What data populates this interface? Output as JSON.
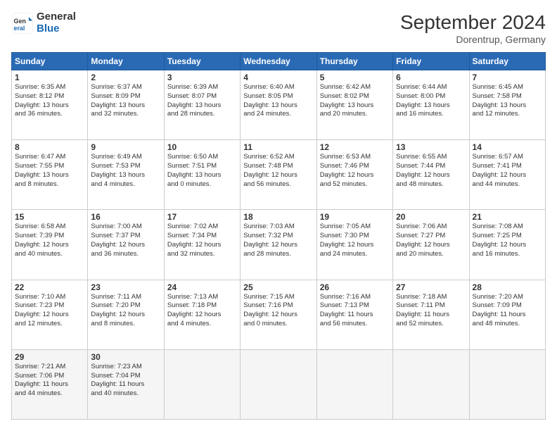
{
  "header": {
    "logo_general": "General",
    "logo_blue": "Blue",
    "title": "September 2024",
    "subtitle": "Dorentrup, Germany"
  },
  "weekdays": [
    "Sunday",
    "Monday",
    "Tuesday",
    "Wednesday",
    "Thursday",
    "Friday",
    "Saturday"
  ],
  "weeks": [
    [
      {
        "day": "1",
        "lines": [
          "Sunrise: 6:35 AM",
          "Sunset: 8:12 PM",
          "Daylight: 13 hours",
          "and 36 minutes."
        ]
      },
      {
        "day": "2",
        "lines": [
          "Sunrise: 6:37 AM",
          "Sunset: 8:09 PM",
          "Daylight: 13 hours",
          "and 32 minutes."
        ]
      },
      {
        "day": "3",
        "lines": [
          "Sunrise: 6:39 AM",
          "Sunset: 8:07 PM",
          "Daylight: 13 hours",
          "and 28 minutes."
        ]
      },
      {
        "day": "4",
        "lines": [
          "Sunrise: 6:40 AM",
          "Sunset: 8:05 PM",
          "Daylight: 13 hours",
          "and 24 minutes."
        ]
      },
      {
        "day": "5",
        "lines": [
          "Sunrise: 6:42 AM",
          "Sunset: 8:02 PM",
          "Daylight: 13 hours",
          "and 20 minutes."
        ]
      },
      {
        "day": "6",
        "lines": [
          "Sunrise: 6:44 AM",
          "Sunset: 8:00 PM",
          "Daylight: 13 hours",
          "and 16 minutes."
        ]
      },
      {
        "day": "7",
        "lines": [
          "Sunrise: 6:45 AM",
          "Sunset: 7:58 PM",
          "Daylight: 13 hours",
          "and 12 minutes."
        ]
      }
    ],
    [
      {
        "day": "8",
        "lines": [
          "Sunrise: 6:47 AM",
          "Sunset: 7:55 PM",
          "Daylight: 13 hours",
          "and 8 minutes."
        ]
      },
      {
        "day": "9",
        "lines": [
          "Sunrise: 6:49 AM",
          "Sunset: 7:53 PM",
          "Daylight: 13 hours",
          "and 4 minutes."
        ]
      },
      {
        "day": "10",
        "lines": [
          "Sunrise: 6:50 AM",
          "Sunset: 7:51 PM",
          "Daylight: 13 hours",
          "and 0 minutes."
        ]
      },
      {
        "day": "11",
        "lines": [
          "Sunrise: 6:52 AM",
          "Sunset: 7:48 PM",
          "Daylight: 12 hours",
          "and 56 minutes."
        ]
      },
      {
        "day": "12",
        "lines": [
          "Sunrise: 6:53 AM",
          "Sunset: 7:46 PM",
          "Daylight: 12 hours",
          "and 52 minutes."
        ]
      },
      {
        "day": "13",
        "lines": [
          "Sunrise: 6:55 AM",
          "Sunset: 7:44 PM",
          "Daylight: 12 hours",
          "and 48 minutes."
        ]
      },
      {
        "day": "14",
        "lines": [
          "Sunrise: 6:57 AM",
          "Sunset: 7:41 PM",
          "Daylight: 12 hours",
          "and 44 minutes."
        ]
      }
    ],
    [
      {
        "day": "15",
        "lines": [
          "Sunrise: 6:58 AM",
          "Sunset: 7:39 PM",
          "Daylight: 12 hours",
          "and 40 minutes."
        ]
      },
      {
        "day": "16",
        "lines": [
          "Sunrise: 7:00 AM",
          "Sunset: 7:37 PM",
          "Daylight: 12 hours",
          "and 36 minutes."
        ]
      },
      {
        "day": "17",
        "lines": [
          "Sunrise: 7:02 AM",
          "Sunset: 7:34 PM",
          "Daylight: 12 hours",
          "and 32 minutes."
        ]
      },
      {
        "day": "18",
        "lines": [
          "Sunrise: 7:03 AM",
          "Sunset: 7:32 PM",
          "Daylight: 12 hours",
          "and 28 minutes."
        ]
      },
      {
        "day": "19",
        "lines": [
          "Sunrise: 7:05 AM",
          "Sunset: 7:30 PM",
          "Daylight: 12 hours",
          "and 24 minutes."
        ]
      },
      {
        "day": "20",
        "lines": [
          "Sunrise: 7:06 AM",
          "Sunset: 7:27 PM",
          "Daylight: 12 hours",
          "and 20 minutes."
        ]
      },
      {
        "day": "21",
        "lines": [
          "Sunrise: 7:08 AM",
          "Sunset: 7:25 PM",
          "Daylight: 12 hours",
          "and 16 minutes."
        ]
      }
    ],
    [
      {
        "day": "22",
        "lines": [
          "Sunrise: 7:10 AM",
          "Sunset: 7:23 PM",
          "Daylight: 12 hours",
          "and 12 minutes."
        ]
      },
      {
        "day": "23",
        "lines": [
          "Sunrise: 7:11 AM",
          "Sunset: 7:20 PM",
          "Daylight: 12 hours",
          "and 8 minutes."
        ]
      },
      {
        "day": "24",
        "lines": [
          "Sunrise: 7:13 AM",
          "Sunset: 7:18 PM",
          "Daylight: 12 hours",
          "and 4 minutes."
        ]
      },
      {
        "day": "25",
        "lines": [
          "Sunrise: 7:15 AM",
          "Sunset: 7:16 PM",
          "Daylight: 12 hours",
          "and 0 minutes."
        ]
      },
      {
        "day": "26",
        "lines": [
          "Sunrise: 7:16 AM",
          "Sunset: 7:13 PM",
          "Daylight: 11 hours",
          "and 56 minutes."
        ]
      },
      {
        "day": "27",
        "lines": [
          "Sunrise: 7:18 AM",
          "Sunset: 7:11 PM",
          "Daylight: 11 hours",
          "and 52 minutes."
        ]
      },
      {
        "day": "28",
        "lines": [
          "Sunrise: 7:20 AM",
          "Sunset: 7:09 PM",
          "Daylight: 11 hours",
          "and 48 minutes."
        ]
      }
    ],
    [
      {
        "day": "29",
        "lines": [
          "Sunrise: 7:21 AM",
          "Sunset: 7:06 PM",
          "Daylight: 11 hours",
          "and 44 minutes."
        ]
      },
      {
        "day": "30",
        "lines": [
          "Sunrise: 7:23 AM",
          "Sunset: 7:04 PM",
          "Daylight: 11 hours",
          "and 40 minutes."
        ]
      },
      {
        "day": "",
        "lines": []
      },
      {
        "day": "",
        "lines": []
      },
      {
        "day": "",
        "lines": []
      },
      {
        "day": "",
        "lines": []
      },
      {
        "day": "",
        "lines": []
      }
    ]
  ]
}
